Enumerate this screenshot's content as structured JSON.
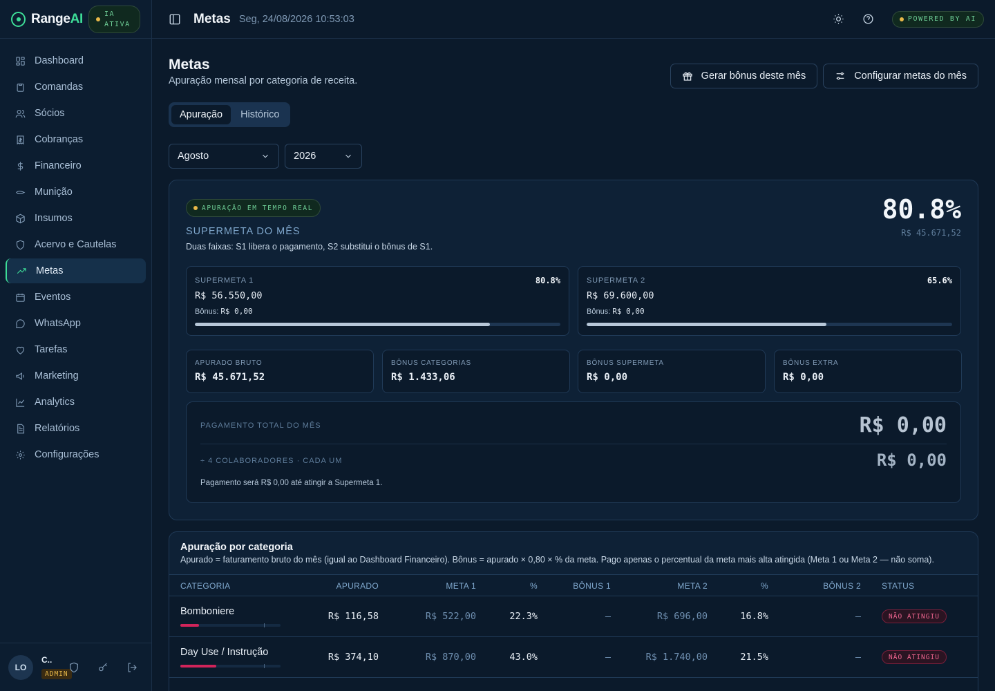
{
  "app": {
    "brand_name": "Range",
    "brand_ai": "AI",
    "ia_badge_1": "IA",
    "ia_badge_2": "ATIVA",
    "accent": "#3ddc97"
  },
  "sidebar": {
    "items": [
      {
        "label": "Dashboard",
        "icon": "dashboard-icon"
      },
      {
        "label": "Comandas",
        "icon": "clipboard-icon"
      },
      {
        "label": "Sócios",
        "icon": "users-icon"
      },
      {
        "label": "Cobranças",
        "icon": "receipt-icon"
      },
      {
        "label": "Financeiro",
        "icon": "dollar-icon"
      },
      {
        "label": "Munição",
        "icon": "ammo-icon"
      },
      {
        "label": "Insumos",
        "icon": "package-icon"
      },
      {
        "label": "Acervo e Cautelas",
        "icon": "shield-icon"
      },
      {
        "label": "Metas",
        "icon": "trending-up-icon"
      },
      {
        "label": "Eventos",
        "icon": "calendar-icon"
      },
      {
        "label": "WhatsApp",
        "icon": "chat-icon"
      },
      {
        "label": "Tarefas",
        "icon": "heart-icon"
      },
      {
        "label": "Marketing",
        "icon": "megaphone-icon"
      },
      {
        "label": "Analytics",
        "icon": "chart-line-icon"
      },
      {
        "label": "Relatórios",
        "icon": "file-icon"
      },
      {
        "label": "Configurações",
        "icon": "gear-icon"
      }
    ],
    "active_index": 8
  },
  "user": {
    "initials": "LO",
    "name": "C..",
    "role": "ADMIN"
  },
  "topbar": {
    "title": "Metas",
    "datetime": "Seg, 24/08/2026 10:53:03",
    "powered": "POWERED BY AI"
  },
  "page": {
    "title": "Metas",
    "subtitle": "Apuração mensal por categoria de receita.",
    "btn_bonus": "Gerar bônus deste mês",
    "btn_config": "Configurar metas do mês",
    "tabs": [
      "Apuração",
      "Histórico"
    ],
    "month": "Agosto",
    "year": "2026"
  },
  "supermeta": {
    "badge": "APURAÇÃO EM TEMPO REAL",
    "title": "SUPERMETA DO MÊS",
    "desc": "Duas faixas: S1 libera o pagamento, S2 substitui o bônus de S1.",
    "pct": "80.8%",
    "value": "R$ 45.671,52",
    "s1": {
      "label": "SUPERMETA 1",
      "pct": "80.8%",
      "value": "R$ 56.550,00",
      "bonus_label": "Bônus:",
      "bonus": "R$ 0,00",
      "progress": 0.808
    },
    "s2": {
      "label": "SUPERMETA 2",
      "pct": "65.6%",
      "value": "R$ 69.600,00",
      "bonus_label": "Bônus:",
      "bonus": "R$ 0,00",
      "progress": 0.656
    }
  },
  "stats": [
    {
      "label": "APURADO BRUTO",
      "value": "R$ 45.671,52"
    },
    {
      "label": "BÔNUS CATEGORIAS",
      "value": "R$ 1.433,06"
    },
    {
      "label": "BÔNUS SUPERMETA",
      "value": "R$ 0,00"
    },
    {
      "label": "BÔNUS EXTRA",
      "value": "R$ 0,00"
    }
  ],
  "payment": {
    "label": "PAGAMENTO TOTAL DO MÊS",
    "value": "R$ 0,00",
    "label2": "÷ 4 COLABORADORES · CADA UM",
    "value2": "R$ 0,00",
    "note": "Pagamento será R$ 0,00 até atingir a Supermeta 1."
  },
  "category": {
    "title": "Apuração por categoria",
    "desc": "Apurado = faturamento bruto do mês (igual ao Dashboard Financeiro). Bônus = apurado × 0,80 × % da meta. Pago apenas o percentual da meta mais alta atingida (Meta 1 ou Meta 2 — não soma).",
    "headers": [
      "CATEGORIA",
      "APURADO",
      "META 1",
      "%",
      "BÔNUS 1",
      "META 2",
      "%",
      "BÔNUS 2",
      "STATUS"
    ],
    "rows": [
      {
        "name": "Bomboniere",
        "apurado": "R$ 116,58",
        "meta1": "R$ 522,00",
        "pct1": "22.3%",
        "bonus1": "—",
        "meta2": "R$ 696,00",
        "pct2": "16.8%",
        "bonus2": "—",
        "status": "NÃO ATINGIU",
        "progress": 0.186
      },
      {
        "name": "Day Use / Instrução",
        "apurado": "R$ 374,10",
        "meta1": "R$ 870,00",
        "pct1": "43.0%",
        "bonus1": "—",
        "meta2": "R$ 1.740,00",
        "pct2": "21.5%",
        "bonus2": "—",
        "status": "NÃO ATINGIU",
        "progress": 0.358
      }
    ],
    "status_color": "#f06690"
  }
}
